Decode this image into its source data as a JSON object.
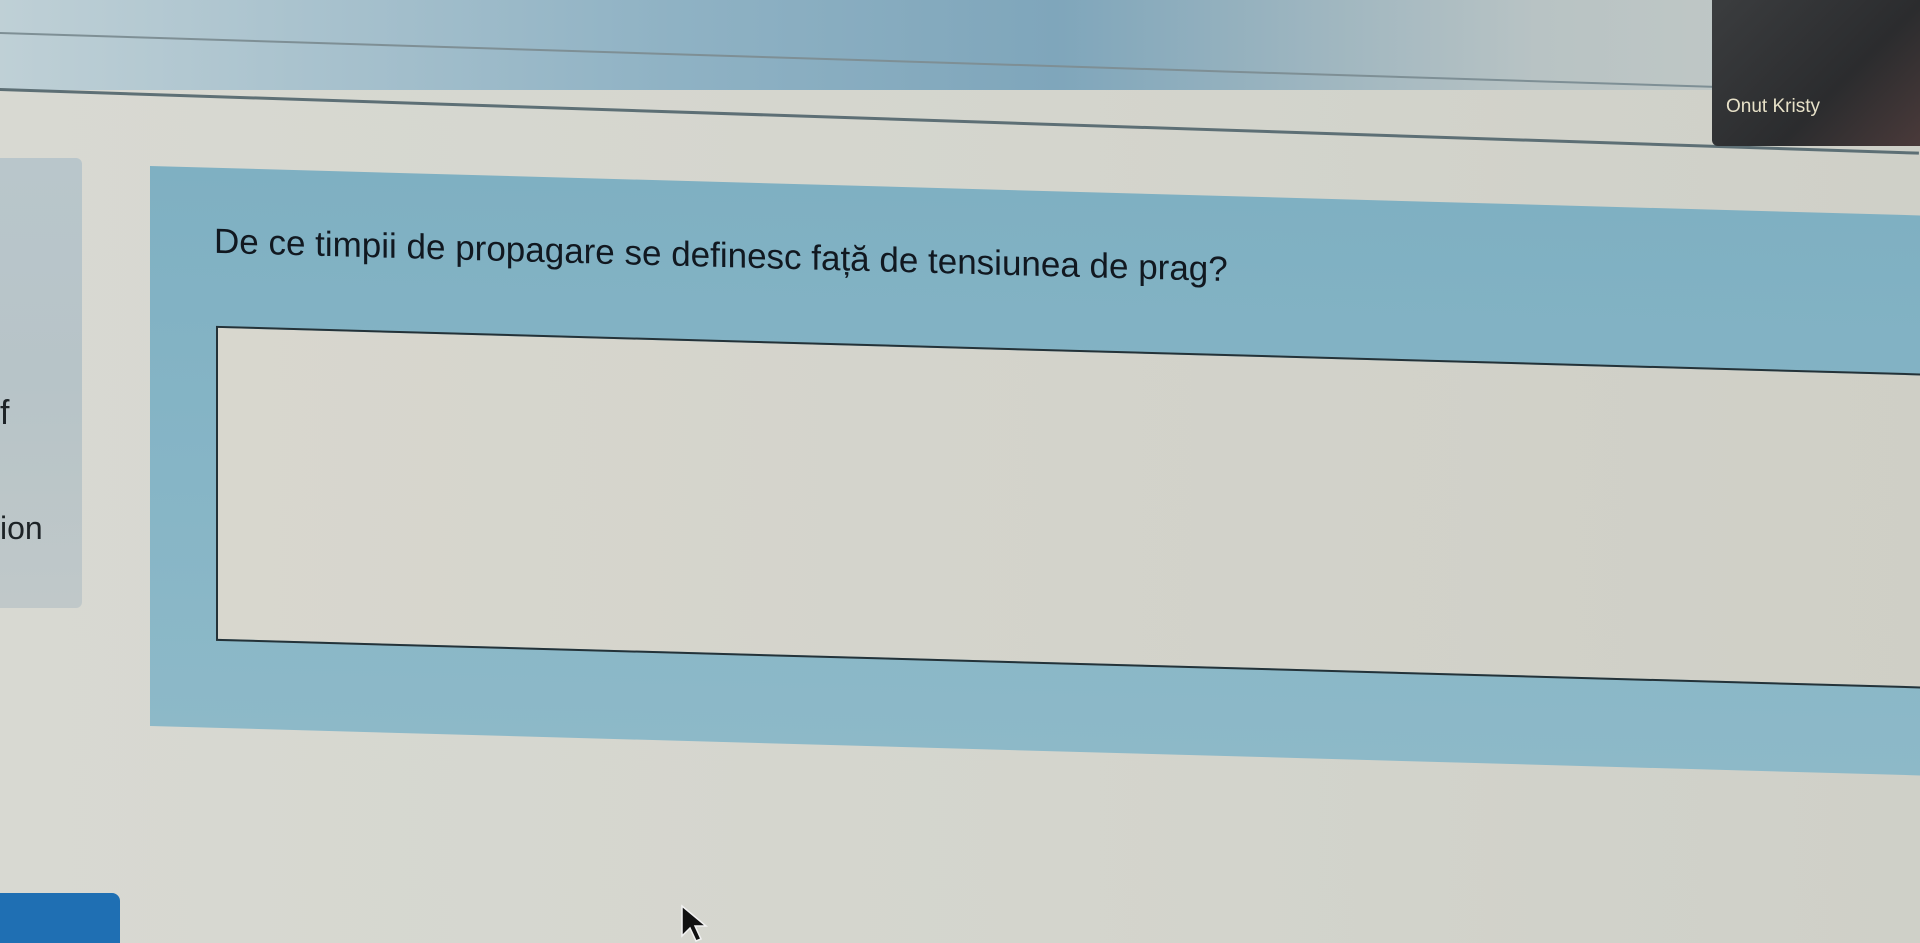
{
  "video": {
    "participant_name": "Onut Kristy"
  },
  "sidebar": {
    "fragment_1": "f",
    "fragment_2": "ion"
  },
  "question": {
    "text": "De ce timpii de propagare se definesc față de tensiunea de prag?",
    "answer_value": ""
  },
  "icons": {
    "cursor": "mouse-pointer-icon"
  },
  "colors": {
    "card": "#86b5c6",
    "answer_bg": "#d6d5cc",
    "button": "#1f6fb3"
  }
}
